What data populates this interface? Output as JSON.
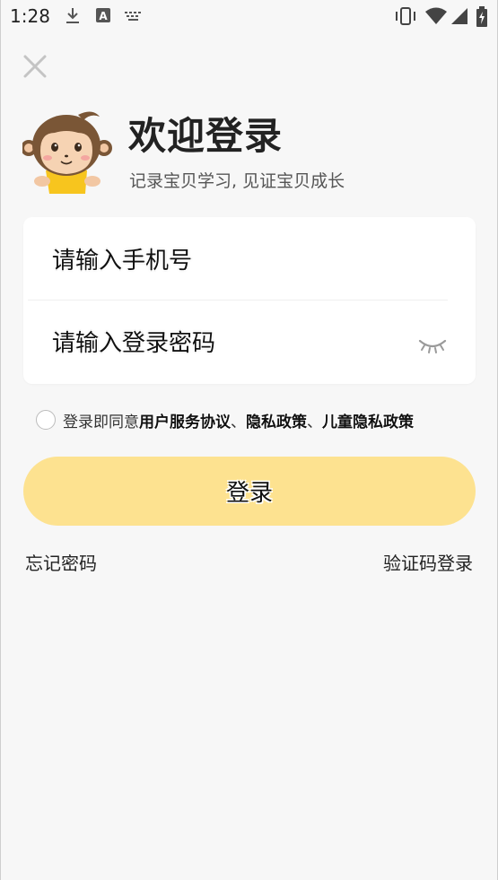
{
  "status_bar": {
    "time": "1:28",
    "icons": [
      "download-icon",
      "text-a-icon",
      "keyboard-icon",
      "vibrate-icon",
      "wifi-icon",
      "signal-icon",
      "battery-charging-icon"
    ]
  },
  "header": {
    "title": "欢迎登录",
    "subtitle": "记录宝贝学习, 见证宝贝成长"
  },
  "form": {
    "phone_placeholder": "请输入手机号",
    "password_placeholder": "请输入登录密码"
  },
  "agreement": {
    "prefix": "登录即同意 ",
    "links": [
      "用户服务协议",
      "隐私政策",
      "儿童隐私政策"
    ],
    "separator": "、"
  },
  "login_button": "登录",
  "footer": {
    "forgot": "忘记密码",
    "sms_login": "验证码登录"
  },
  "colors": {
    "accent": "#fde290",
    "background": "#f7f7f7",
    "card": "#ffffff"
  }
}
